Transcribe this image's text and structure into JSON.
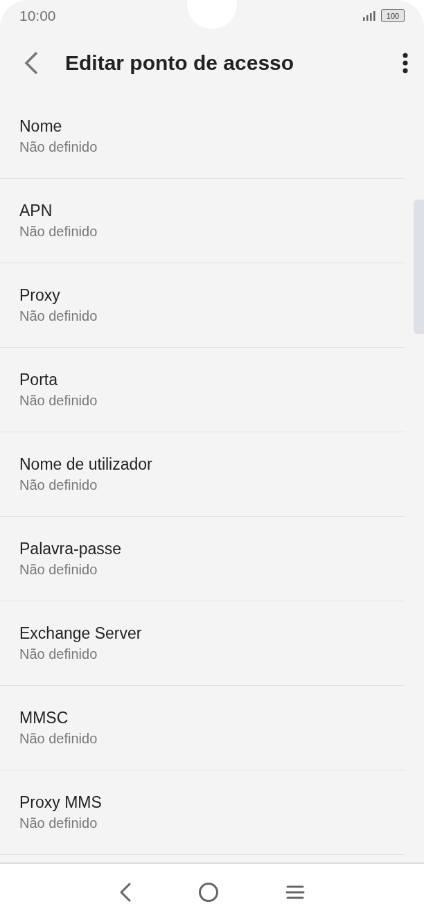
{
  "status_bar": {
    "time": "10:00",
    "battery": "100"
  },
  "app_bar": {
    "title": "Editar ponto de acesso"
  },
  "settings": [
    {
      "title": "Nome",
      "value": "Não definido"
    },
    {
      "title": "APN",
      "value": "Não definido"
    },
    {
      "title": "Proxy",
      "value": "Não definido"
    },
    {
      "title": "Porta",
      "value": "Não definido"
    },
    {
      "title": "Nome de utilizador",
      "value": "Não definido"
    },
    {
      "title": "Palavra-passe",
      "value": "Não definido"
    },
    {
      "title": "Exchange Server",
      "value": "Não definido"
    },
    {
      "title": "MMSC",
      "value": "Não definido"
    },
    {
      "title": "Proxy MMS",
      "value": "Não definido"
    }
  ]
}
